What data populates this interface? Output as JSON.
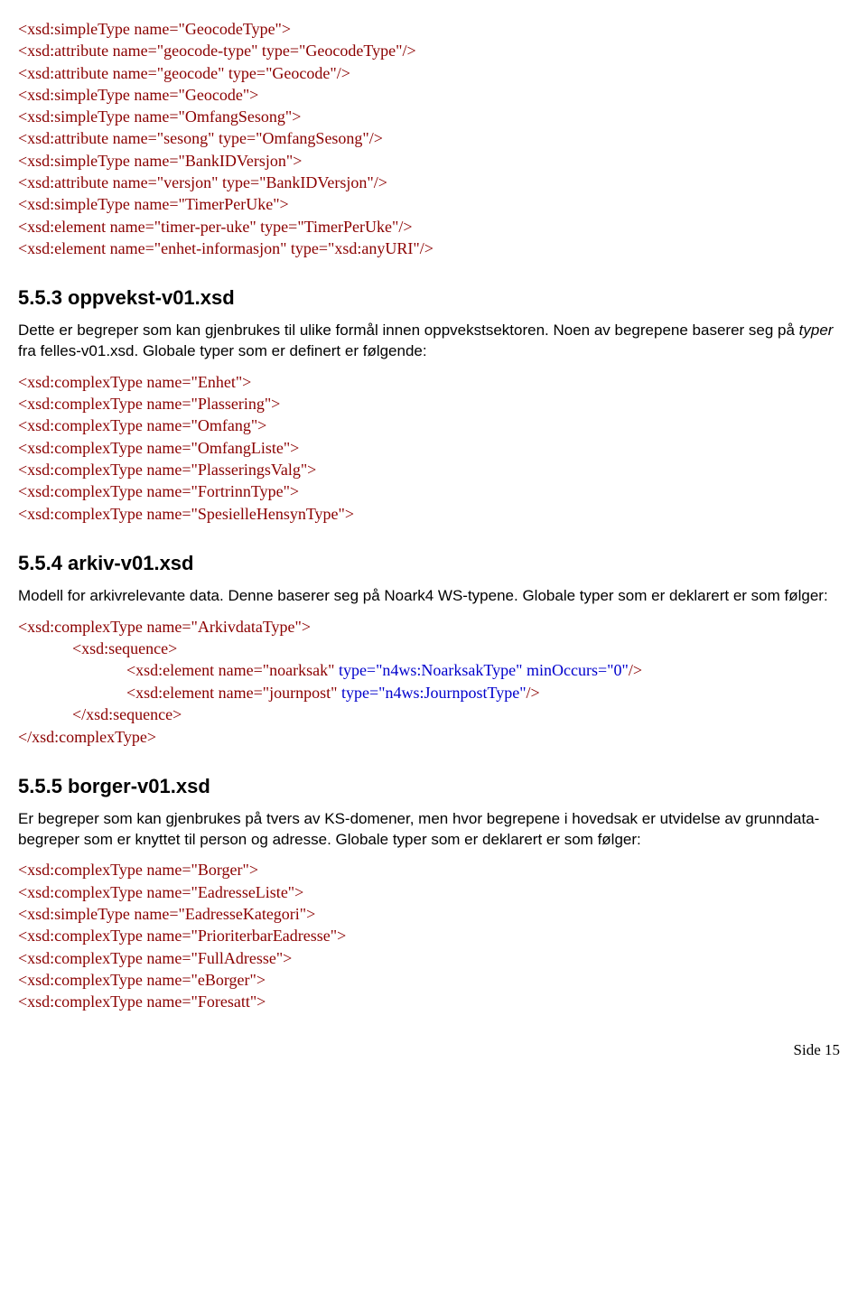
{
  "block1": {
    "lines": [
      "<xsd:simpleType name=\"GeocodeType\">",
      "<xsd:attribute name=\"geocode-type\" type=\"GeocodeType\"/>",
      "<xsd:attribute name=\"geocode\" type=\"Geocode\"/>",
      "<xsd:simpleType name=\"Geocode\">",
      "<xsd:simpleType name=\"OmfangSesong\">",
      "<xsd:attribute name=\"sesong\" type=\"OmfangSesong\"/>",
      "<xsd:simpleType name=\"BankIDVersjon\">",
      "<xsd:attribute name=\"versjon\" type=\"BankIDVersjon\"/>",
      "<xsd:simpleType name=\"TimerPerUke\">",
      "<xsd:element name=\"timer-per-uke\" type=\"TimerPerUke\"/>",
      "<xsd:element name=\"enhet-informasjon\" type=\"xsd:anyURI\"/>"
    ]
  },
  "sec553": {
    "heading": "5.5.3   oppvekst-v01.xsd",
    "para_pre": "Dette er begreper som kan gjenbrukes til ulike formål innen oppvekstsektoren. Noen av begrepene baserer seg på ",
    "para_italic": "typer",
    "para_post": " fra felles-v01.xsd. Globale typer som er definert er følgende:"
  },
  "block2": {
    "lines": [
      "<xsd:complexType name=\"Enhet\">",
      "<xsd:complexType name=\"Plassering\">",
      "<xsd:complexType name=\"Omfang\">",
      "<xsd:complexType name=\"OmfangListe\">",
      "<xsd:complexType name=\"PlasseringsValg\">",
      "<xsd:complexType name=\"FortrinnType\">",
      "<xsd:complexType name=\"SpesielleHensynType\">"
    ]
  },
  "sec554": {
    "heading": "5.5.4   arkiv-v01.xsd",
    "para": "Modell for arkivrelevante data. Denne baserer seg på Noark4 WS-typene. Globale typer som er deklarert er som følger:"
  },
  "block3": {
    "line1": "<xsd:complexType name=\"ArkivdataType\">",
    "seq_open": "<xsd:sequence>",
    "el1_a": "<xsd:element name=\"noarksak\" ",
    "el1_b": "type=\"n4ws:NoarksakType\" ",
    "el1_c": "minOccurs=\"0\"",
    "el1_d": "/>",
    "el2_a": "<xsd:element name=\"journpost\" ",
    "el2_b": "type=\"n4ws:JournpostType\"",
    "el2_c": "/>",
    "seq_close": "</xsd:sequence>",
    "ct_close": "</xsd:complexType>"
  },
  "sec555": {
    "heading": "5.5.5   borger-v01.xsd",
    "para": "Er begreper som kan gjenbrukes på tvers av KS-domener, men hvor begrepene i hovedsak er utvidelse av grunndata-begreper som er knyttet til person og adresse. Globale typer som er deklarert er som følger:"
  },
  "block4": {
    "lines": [
      "<xsd:complexType name=\"Borger\">",
      "<xsd:complexType name=\"EadresseListe\">",
      "<xsd:simpleType name=\"EadresseKategori\">",
      "<xsd:complexType name=\"PrioriterbarEadresse\">",
      "<xsd:complexType name=\"FullAdresse\">",
      "<xsd:complexType name=\"eBorger\">",
      "<xsd:complexType name=\"Foresatt\">"
    ]
  },
  "page": "Side 15"
}
